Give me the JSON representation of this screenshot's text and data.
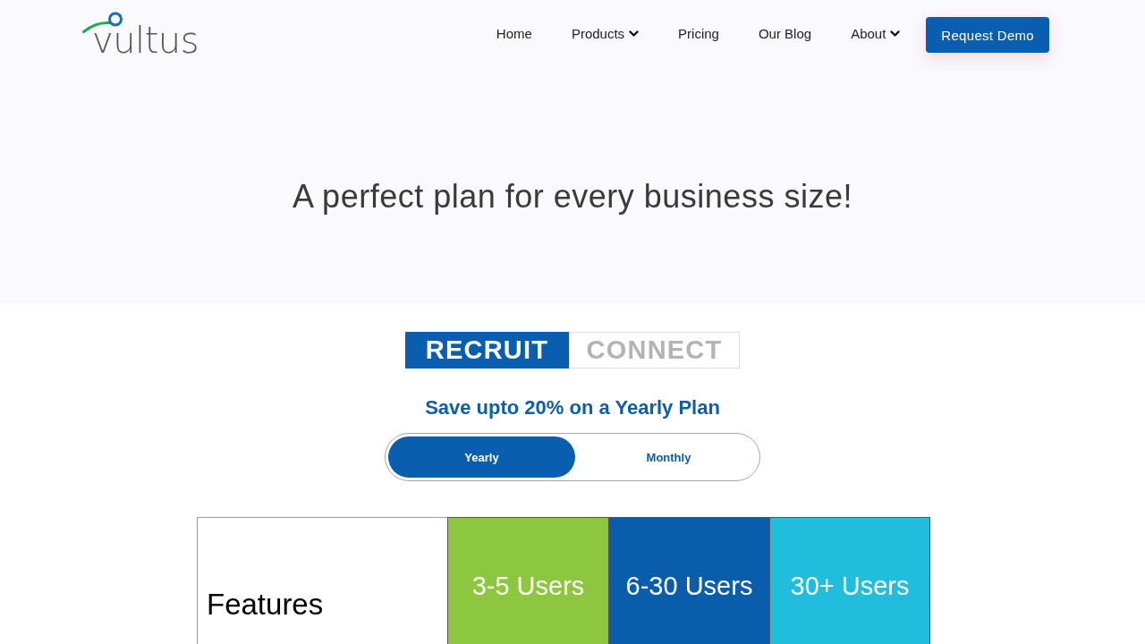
{
  "header": {
    "logo": "vultus",
    "nav": [
      {
        "label": "Home",
        "dropdown": false
      },
      {
        "label": "Products",
        "dropdown": true
      },
      {
        "label": "Pricing",
        "dropdown": false
      },
      {
        "label": "Our Blog",
        "dropdown": false
      },
      {
        "label": "About",
        "dropdown": true
      }
    ],
    "cta": "Request Demo"
  },
  "hero": {
    "title": "A perfect plan for every business size!"
  },
  "product_tabs": [
    {
      "label": "RECRUIT",
      "selected": true
    },
    {
      "label": "CONNECT",
      "selected": false
    }
  ],
  "promo": "Save upto 20% on a Yearly Plan",
  "billing_toggle": [
    {
      "label": "Yearly",
      "selected": true
    },
    {
      "label": "Monthly",
      "selected": false
    }
  ],
  "table": {
    "features_heading": "Features",
    "plans": [
      {
        "label": "3-5 Users",
        "color": "#8dc63f"
      },
      {
        "label": "6-30 Users",
        "color": "#0a5dab"
      },
      {
        "label": "30+ Users",
        "color": "#21bddc"
      }
    ]
  }
}
